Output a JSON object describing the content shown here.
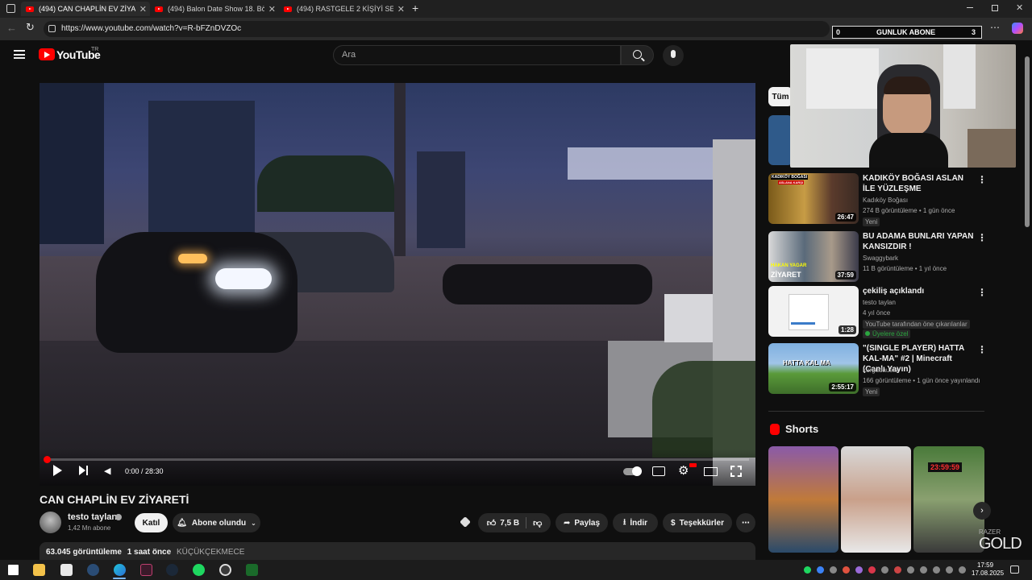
{
  "browser": {
    "tabs": [
      {
        "title": "(494) CAN CHAPLİN EV ZİYARETİ",
        "active": true
      },
      {
        "title": "(494) Balon Date Show 18. Bölüm",
        "active": false
      },
      {
        "title": "(494) RASTGELE 2 KİŞİYİ SEVGİLİ Y",
        "active": false
      }
    ],
    "url": "https://www.youtube.com/watch?v=R-bFZnDVZOc",
    "sub_counter": {
      "left": "0",
      "label": "GUNLUK ABONE",
      "right": "3"
    }
  },
  "youtube": {
    "logo_text": "YouTube",
    "region": "TR",
    "search_placeholder": "Ara",
    "filter_chip": "Tüm"
  },
  "video": {
    "time": "0:00 / 28:30",
    "progress": 0.0,
    "title": "CAN CHAPLİN EV ZİYARETİ",
    "channel": "testo taylan",
    "subscribers": "1,42 Mn abone",
    "join_label": "Katıl",
    "subscribed_label": "Abone olundu",
    "likes": "7,5 B",
    "share_label": "Paylaş",
    "download_label": "İndir",
    "thanks_label": "Teşekkürler",
    "views": "63.045 görüntüleme",
    "age": "1 saat önce",
    "location": "KÜÇÜKÇEKMECE"
  },
  "related": [
    {
      "title": "KADIKÖY BOĞASI ASLAN İLE YÜZLEŞME",
      "channel": "Kadıköy Boğası",
      "meta": "274 B görüntüleme • 1 gün önce",
      "badge": "Yeni",
      "duration": "26:47"
    },
    {
      "title": "BU ADAMA BUNLARI YAPAN KANSIZDIR !",
      "channel": "Swaggybark",
      "meta": "11 B görüntüleme • 1 yıl önce",
      "duration": "37:59"
    },
    {
      "title": "çekiliş açıklandı",
      "channel": "testo taylan",
      "meta": "4 yıl önce",
      "extra": "YouTube tarafından öne çıkarılanlar",
      "badge": "Üyelere özel",
      "duration": "1:28"
    },
    {
      "title": "\"(SINGLE PLAYER) HATTA KAL-MA\" #2 | Minecraft (Canlı Yayın)",
      "channel": "kurgudausta",
      "meta": "166 görüntüleme • 1 gün önce yayınlandı",
      "badge": "Yeni",
      "duration": "2:55:17"
    }
  ],
  "shorts_label": "Shorts",
  "thumb_texts": {
    "t1_top": "KADIKÖY BOĞASI",
    "t1_sub": "ASLANA KARŞI",
    "t2_a": "HAKAN YAGAR",
    "t2_b": "ZİYARET",
    "t4": "HATTA KAL MA",
    "short3_timer": "23:59:59"
  },
  "overlay": {
    "brand": "GOLD",
    "brand_small": "RAZER"
  },
  "taskbar": {
    "time": "17:59",
    "date": "17.08.2025"
  }
}
